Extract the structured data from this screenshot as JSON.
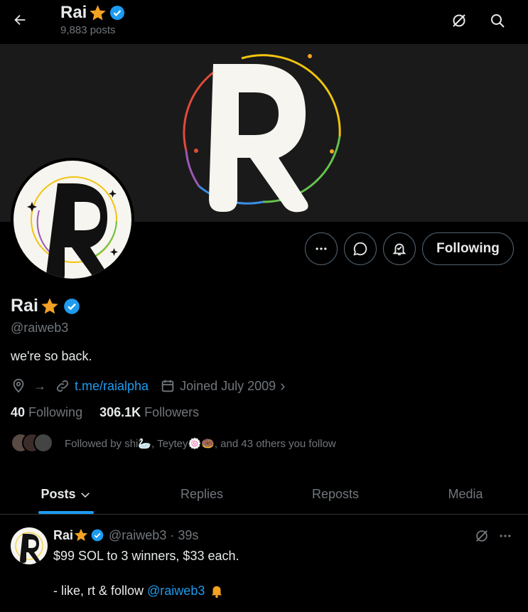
{
  "header": {
    "name": "Rai",
    "posts_count": "9,883 posts"
  },
  "profile": {
    "name": "Rai",
    "handle": "@raiweb3",
    "bio": "we're so back.",
    "link": "t.me/raialpha",
    "joined": "Joined July 2009",
    "following_count": "40",
    "following_label": "Following",
    "followers_count": "306.1K",
    "followers_label": "Followers",
    "followed_by": "Followed by shi🦢, Teytey🍥🍩, and 43 others you follow"
  },
  "actions": {
    "following_button": "Following"
  },
  "tabs": [
    {
      "label": "Posts",
      "active": true
    },
    {
      "label": "Replies",
      "active": false
    },
    {
      "label": "Reposts",
      "active": false
    },
    {
      "label": "Media",
      "active": false
    }
  ],
  "post": {
    "name": "Rai",
    "meta": "@raiweb3 · 39s",
    "line1": "$99 SOL to 3 winners, $33 each.",
    "line2_prefix": "- like, rt & follow",
    "line2_mention": "@raiweb3"
  },
  "colors": {
    "accent": "#1d9bf0",
    "background": "#000000",
    "muted": "#71767b",
    "verified": "#1d9bf0",
    "star": "#f4a223"
  },
  "icons": [
    "back-arrow-icon",
    "grok-icon",
    "search-icon",
    "more-icon",
    "message-icon",
    "notification-bell-icon",
    "verified-badge-icon",
    "star-emoji-icon",
    "location-icon",
    "link-icon",
    "calendar-icon",
    "bell-emoji-icon"
  ]
}
